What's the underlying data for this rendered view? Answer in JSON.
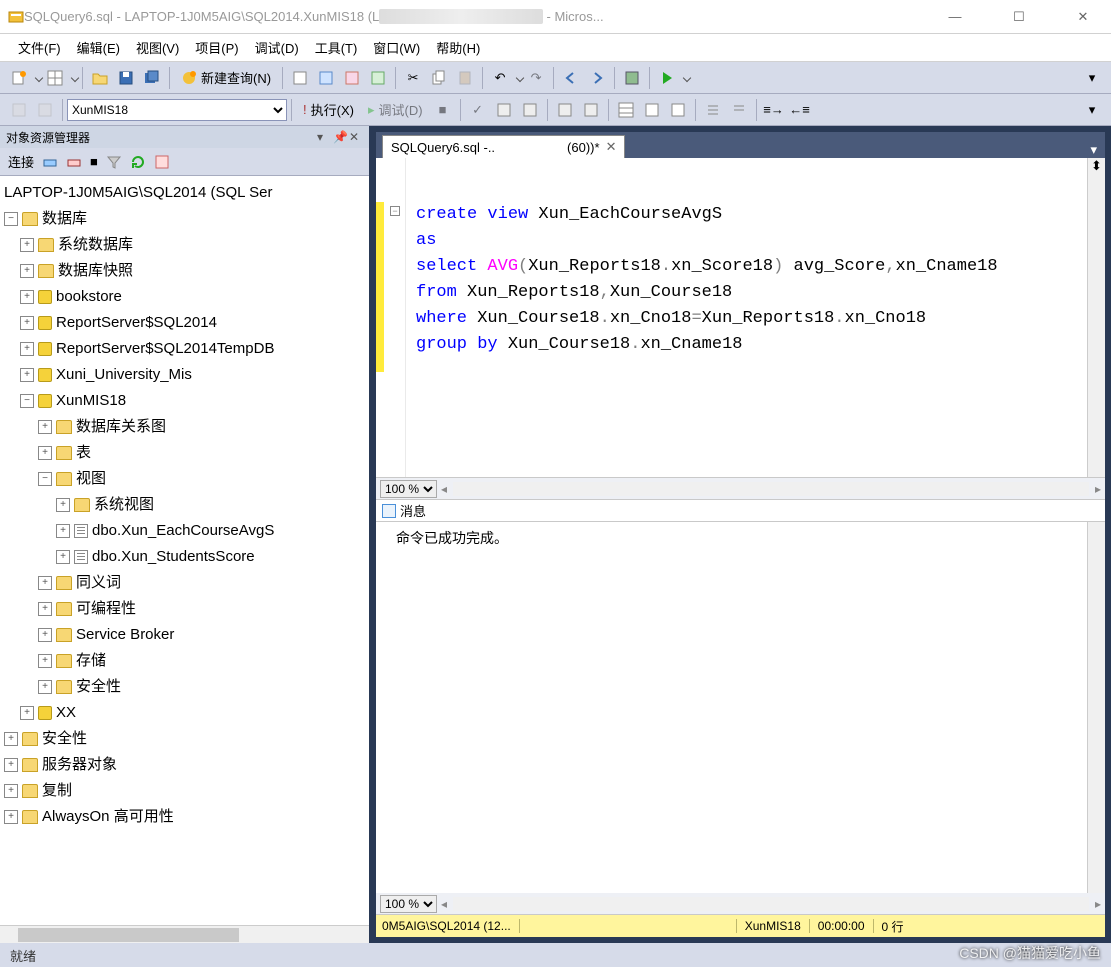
{
  "titlebar": {
    "title_prefix": "SQLQuery6.sql - LAPTOP-1J0M5AIG\\SQL2014.XunMIS18 (L",
    "title_suffix": " - Micros..."
  },
  "menu": [
    "文件(F)",
    "编辑(E)",
    "视图(V)",
    "项目(P)",
    "调试(D)",
    "工具(T)",
    "窗口(W)",
    "帮助(H)"
  ],
  "toolbar1": {
    "new_query": "新建查询(N)"
  },
  "toolbar2": {
    "db": "XunMIS18",
    "execute": "执行(X)",
    "debug": "调试(D)"
  },
  "object_explorer": {
    "title": "对象资源管理器",
    "connect": "连接",
    "root": "LAPTOP-1J0M5AIG\\SQL2014 (SQL Ser",
    "nodes": {
      "databases": "数据库",
      "sysdb": "系统数据库",
      "snapshots": "数据库快照",
      "bookstore": "bookstore",
      "rs": "ReportServer$SQL2014",
      "rstemp": "ReportServer$SQL2014TempDB",
      "xuni": "Xuni_University_Mis",
      "xunmis": "XunMIS18",
      "diagrams": "数据库关系图",
      "tables": "表",
      "views": "视图",
      "sysviews": "系统视图",
      "v1": "dbo.Xun_EachCourseAvgS",
      "v2": "dbo.Xun_StudentsScore",
      "synonyms": "同义词",
      "programmability": "可编程性",
      "sb": "Service Broker",
      "storage": "存储",
      "security_db": "安全性",
      "xx": "XX",
      "security": "安全性",
      "server_objects": "服务器对象",
      "replication": "复制",
      "alwayson": "AlwaysOn 高可用性"
    }
  },
  "tab": {
    "label_prefix": "SQLQuery6.sql -..",
    "label_suffix": "(60))*"
  },
  "code": {
    "line1_kw1": "create",
    "line1_kw2": "view",
    "line1_id": " Xun_EachCourseAvgS",
    "line2_kw": "as",
    "line3_kw": "select",
    "line3_fn": "AVG",
    "line3_rest": "Xun_Reports18",
    "line3_dot": ".",
    "line3_col": "xn_Score18",
    "line3_tail": " avg_Score",
    "line3_comma": ",",
    "line3_c2": "xn_Cname18",
    "line4_kw": "from",
    "line4_rest": " Xun_Reports18",
    "line4_comma": ",",
    "line4_t2": "Xun_Course18",
    "line5_kw": "where",
    "line5_rest": " Xun_Course18",
    "line5_dot": ".",
    "line5_c": "xn_Cno18",
    "line5_eq": "=",
    "line5_r": "Xun_Reports18",
    "line5_dot2": ".",
    "line5_c2": "xn_Cno18",
    "line6_kw1": "group",
    "line6_kw2": "by",
    "line6_rest": " Xun_Course18",
    "line6_dot": ".",
    "line6_col": "xn_Cname18"
  },
  "zoom": "100 %",
  "messages": {
    "tab": "消息",
    "body": "命令已成功完成。"
  },
  "status_yellow": {
    "server": "0M5AIG\\SQL2014 (12...",
    "db": "XunMIS18",
    "time": "00:00:00",
    "rows": "0 行"
  },
  "statusbar": {
    "ready": "就绪"
  },
  "watermark": "CSDN @猫猫爱吃小鱼"
}
